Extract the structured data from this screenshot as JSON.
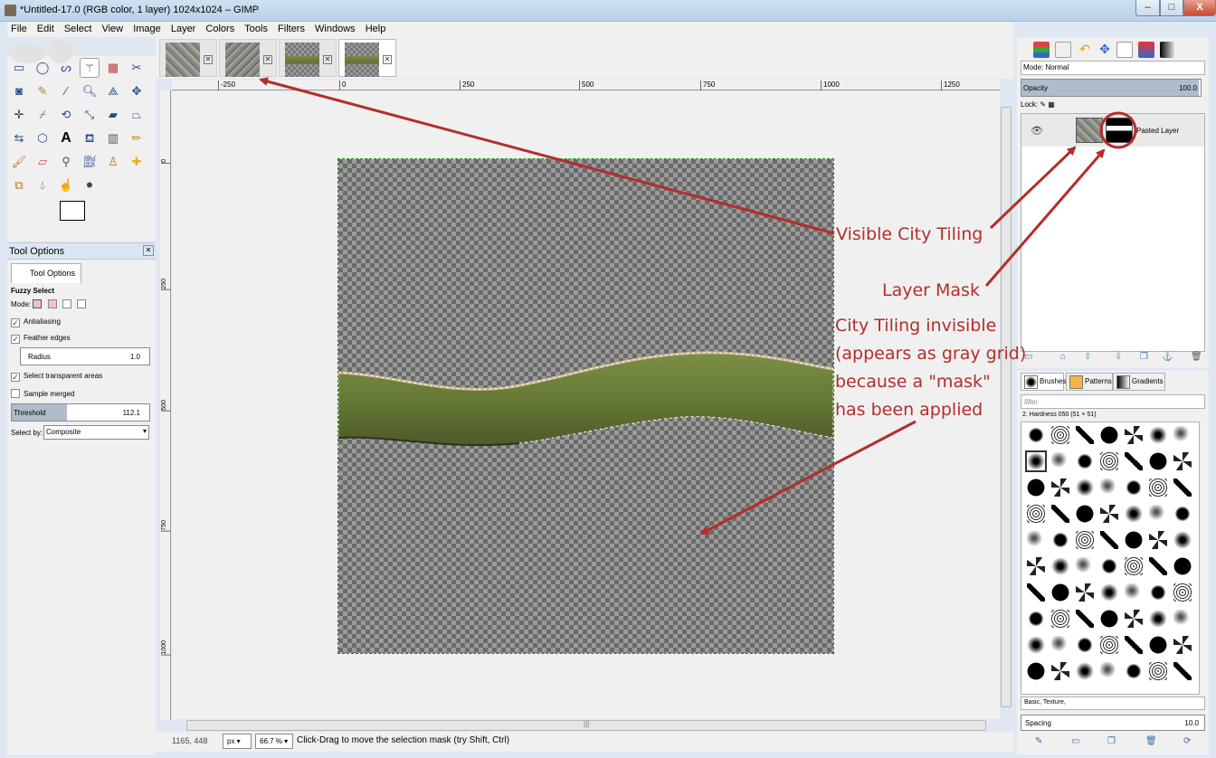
{
  "window": {
    "title": "*Untitled-17.0 (RGB color, 1 layer) 1024x1024 – GIMP",
    "min_label": "–",
    "max_label": "□",
    "close_label": "X"
  },
  "menu": [
    "File",
    "Edit",
    "Select",
    "View",
    "Image",
    "Layer",
    "Colors",
    "Tools",
    "Filters",
    "Windows",
    "Help"
  ],
  "image_tabs": [
    {
      "thumb": "city-tile",
      "close": "✕"
    },
    {
      "thumb": "city-tile",
      "close": "✕"
    },
    {
      "thumb": "river-strip",
      "close": "✕"
    },
    {
      "thumb": "river-strip",
      "close": "✕"
    }
  ],
  "ruler_h": [
    "-250",
    "0",
    "250",
    "500",
    "750",
    "1000",
    "1250"
  ],
  "ruler_v": [
    "0",
    "250",
    "500",
    "750",
    "1000"
  ],
  "tool_options": {
    "panel_title": "Tool Options",
    "tab_label": "Tool Options",
    "tool_name": "Fuzzy Select",
    "mode_label": "Mode:",
    "antialiasing": "Antialiasing",
    "feather_edges": "Feather edges",
    "radius_label": "Radius",
    "radius_value": "1.0",
    "select_transparent": "Select transparent areas",
    "sample_merged": "Sample merged",
    "threshold_label": "Threshold",
    "threshold_value": "112.1",
    "select_by_label": "Select by:",
    "select_by_value": "Composite"
  },
  "status": {
    "coords": "1165, 448",
    "unit": "px",
    "zoom": "66.7 %",
    "message": "Click-Drag to move the selection mask (try Shift, Ctrl)"
  },
  "layers": {
    "mode_label": "Mode: Normal",
    "opacity_label": "Opacity",
    "opacity_value": "100.0",
    "lock_label": "Lock:",
    "layer_name": "Pasted Layer"
  },
  "brushes": {
    "tab_brushes": "Brushes",
    "tab_patterns": "Patterns",
    "tab_gradients": "Gradients",
    "filter_placeholder": "filter",
    "selected_brush": "2. Hardness 050 (51 × 51)",
    "tags": "Basic, Texture,",
    "spacing_label": "Spacing",
    "spacing_value": "10.0"
  },
  "annotations": {
    "visible_tiling": "Visible City Tiling",
    "layer_mask": "Layer Mask",
    "invisible_line1": "City Tiling invisible",
    "invisible_line2": "(appears as gray grid)",
    "invisible_line3": "because a \"mask\"",
    "invisible_line4": "has been applied",
    "color": "#b42d2d"
  }
}
